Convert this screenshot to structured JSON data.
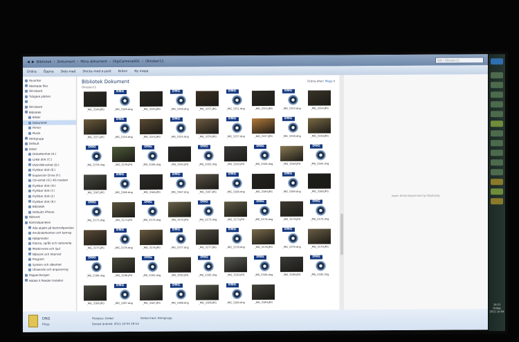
{
  "address": {
    "crumbs": [
      "Bibliotek",
      "Dokument",
      "Mina dokument",
      "DigiCamera001",
      "Oktober11"
    ],
    "search_placeholder": "Sök i Oktober11"
  },
  "toolbar": {
    "items": [
      "Ordna",
      "Öppna",
      "Dela med",
      "Skicka med e-post",
      "Bränn",
      "Ny mapp"
    ]
  },
  "nav": {
    "items": [
      {
        "label": "Favoriter"
      },
      {
        "label": "Hämtade filer"
      },
      {
        "label": "Skrivbord"
      },
      {
        "label": "Tidigare platser"
      },
      {
        "label": ""
      },
      {
        "label": "Skrivbord"
      },
      {
        "label": "Bibliotek"
      },
      {
        "label": "Bilder"
      },
      {
        "label": "Dokument",
        "selected": true
      },
      {
        "label": "Filmer"
      },
      {
        "label": "Musik"
      },
      {
        "label": "Hemgrupp"
      },
      {
        "label": "Default"
      },
      {
        "label": "Dator"
      },
      {
        "label": "Diskettenhet (A:)"
      },
      {
        "label": "Lokal disk (C:)"
      },
      {
        "label": "DVD-RW-enhet (D:)"
      },
      {
        "label": "Flyttbar disk (E:)"
      },
      {
        "label": "Expansion Drive (F:)"
      },
      {
        "label": "CD-enhet (G:) 4G-modem"
      },
      {
        "label": "Flyttbar disk (H:)"
      },
      {
        "label": "Flyttbar disk (I:)"
      },
      {
        "label": "Flyttbar disk (J:)"
      },
      {
        "label": "Flyttbar disk (K:)"
      },
      {
        "label": "Bibliotek"
      },
      {
        "label": "Defaults iPhone"
      },
      {
        "label": "Nätverk"
      },
      {
        "label": "Kontrollpanelen"
      },
      {
        "label": "Alla objekt på Kontrollpanelen"
      },
      {
        "label": "Användarkonton och barnsp"
      },
      {
        "label": "Hjälpmedel"
      },
      {
        "label": "Klocka, språk och nationella"
      },
      {
        "label": "Maskinvara och ljud"
      },
      {
        "label": "Nätverk och Internet"
      },
      {
        "label": "Program"
      },
      {
        "label": "System och säkerhet"
      },
      {
        "label": "Utseende och anpassning"
      },
      {
        "label": "Papperskorgen"
      },
      {
        "label": "Adobe X Reader Installer"
      }
    ]
  },
  "content": {
    "title": "Bibliotek Dokument",
    "subtitle": "Oktober11",
    "arrange_label": "Ordna efter:",
    "arrange_value": "Mapp"
  },
  "files": [
    {
      "name": "_MG_3148.JPG",
      "kind": "photo",
      "color": "#2c2a24"
    },
    {
      "name": "_MG_3149.dng",
      "kind": "dng"
    },
    {
      "name": "_MG_3150.JPG",
      "kind": "photo",
      "color": "#2a2822"
    },
    {
      "name": "_MG_3150.dng",
      "kind": "dng"
    },
    {
      "name": "_MG_3151.JPG",
      "kind": "photo",
      "color": "#3a2f20"
    },
    {
      "name": "_MG_3151.dng",
      "kind": "dng"
    },
    {
      "name": "_MG_3152.JPG",
      "kind": "photo",
      "color": "#2e2b24"
    },
    {
      "name": "_MG_3153.dng",
      "kind": "dng"
    },
    {
      "name": "_MG_3154.JPG",
      "kind": "photo",
      "color": "#3a3428"
    },
    {
      "name": "_MG_3153.JPG",
      "kind": "photo",
      "color": "#6b5a3a"
    },
    {
      "name": "_MG_3154.dng",
      "kind": "dng"
    },
    {
      "name": "_MG_3154.JPG",
      "kind": "photo",
      "color": "#5a4a33"
    },
    {
      "name": "_MG_3155.dng",
      "kind": "dng"
    },
    {
      "name": "_MG_3156.JPG",
      "kind": "photo",
      "color": "#6e5b40"
    },
    {
      "name": "_MG_3157.dng",
      "kind": "dng"
    },
    {
      "name": "_MG_3157.JPG",
      "kind": "photo",
      "color": "#b27a3a"
    },
    {
      "name": "_MG_3158.dng",
      "kind": "dng"
    },
    {
      "name": "_MG_3158.JPG",
      "kind": "photo",
      "color": "#7a6a45"
    },
    {
      "name": "_MG_3159.dng",
      "kind": "dng"
    },
    {
      "name": "_MG_3159.JPG",
      "kind": "photo",
      "color": "#4e5a3a"
    },
    {
      "name": "_MG_3160.dng",
      "kind": "dng"
    },
    {
      "name": "_MG_3161.JPG",
      "kind": "photo",
      "color": "#2a2a2a"
    },
    {
      "name": "_MG_3162.dng",
      "kind": "dng"
    },
    {
      "name": "_MG_3163.JPG",
      "kind": "photo",
      "color": "#3a3a3a"
    },
    {
      "name": "_MG_3164.dng",
      "kind": "dng"
    },
    {
      "name": "_MG_3164.JPG",
      "kind": "photo",
      "color": "#8a7a55"
    },
    {
      "name": "_MG_3165.dng",
      "kind": "dng"
    },
    {
      "name": "_MG_3165.JPG",
      "kind": "photo",
      "color": "#4a4a44"
    },
    {
      "name": "_MG_3166.dng",
      "kind": "dng"
    },
    {
      "name": "_MG_3166.JPG",
      "kind": "photo",
      "color": "#2c2c2a"
    },
    {
      "name": "_MG_3167.dng",
      "kind": "dng"
    },
    {
      "name": "_MG_3167.JPG",
      "kind": "photo",
      "color": "#5a5248"
    },
    {
      "name": "_MG_3168.dng",
      "kind": "dng"
    },
    {
      "name": "_MG_3169.JPG",
      "kind": "photo",
      "color": "#26241f"
    },
    {
      "name": "_MG_3169.dng",
      "kind": "dng"
    },
    {
      "name": "_MG_3168.JPG",
      "kind": "photo",
      "color": "#1e1e1c"
    },
    {
      "name": "_MG_3171.dng",
      "kind": "dng"
    },
    {
      "name": "_MG_3171.JPG",
      "kind": "photo",
      "color": "#5c553f"
    },
    {
      "name": "_MG_3172.dng",
      "kind": "dng"
    },
    {
      "name": "_MG_3172.JPG",
      "kind": "photo",
      "color": "#6a6248"
    },
    {
      "name": "_MG_3173.dng",
      "kind": "dng"
    },
    {
      "name": "_MG_3173.JPG",
      "kind": "photo",
      "color": "#5e5a45"
    },
    {
      "name": "_MG_3174.dng",
      "kind": "dng"
    },
    {
      "name": "_MG_3174.JPG",
      "kind": "photo",
      "color": "#3c3a30"
    },
    {
      "name": "_MG_3175.dng",
      "kind": "dng"
    },
    {
      "name": "_MG_3175.JPG",
      "kind": "photo",
      "color": "#5a4a35"
    },
    {
      "name": "_MG_3176.dng",
      "kind": "dng"
    },
    {
      "name": "_MG_3176.JPG",
      "kind": "photo",
      "color": "#6a5a40"
    },
    {
      "name": "_MG_3177.dng",
      "kind": "dng"
    },
    {
      "name": "_MG_3177.JPG",
      "kind": "photo",
      "color": "#4e4a40"
    },
    {
      "name": "_MG_3178.dng",
      "kind": "dng"
    },
    {
      "name": "_MG_3178.JPG",
      "kind": "photo",
      "color": "#7a6a4a"
    },
    {
      "name": "_MG_3179.dng",
      "kind": "dng"
    },
    {
      "name": "_MG_3179.JPG",
      "kind": "photo",
      "color": "#6a5e44"
    },
    {
      "name": "_MG_3180.dng",
      "kind": "dng"
    },
    {
      "name": "_MG_3180.JPG",
      "kind": "photo",
      "color": "#4a4a3e"
    },
    {
      "name": "_MG_3181.dng",
      "kind": "dng"
    },
    {
      "name": "_MG_3181.JPG",
      "kind": "photo",
      "color": "#4e4a3c"
    },
    {
      "name": "_MG_3182.dng",
      "kind": "dng"
    },
    {
      "name": "_MG_3183.JPG",
      "kind": "photo",
      "color": "#5a5a55"
    },
    {
      "name": "_MG_3184.dng",
      "kind": "dng"
    },
    {
      "name": "_MG_3184.JPG",
      "kind": "photo",
      "color": "#3a3a36"
    },
    {
      "name": "_MG_3185.dng",
      "kind": "dng"
    },
    {
      "name": "_MG_3186.JPG",
      "kind": "photo",
      "color": "#4a4a40"
    },
    {
      "name": "_MG_3187.dng",
      "kind": "dng"
    },
    {
      "name": "_MG_3187.JPG",
      "kind": "photo",
      "color": "#5a5a50"
    },
    {
      "name": "_MG_3188.dng",
      "kind": "dng"
    },
    {
      "name": "_MG_3188.JPG",
      "kind": "photo",
      "color": "#56564c"
    },
    {
      "name": "_MG_3189.dng",
      "kind": "dng"
    },
    {
      "name": "_MG_3189.JPG",
      "kind": "photo",
      "color": "#44443c"
    }
  ],
  "preview": {
    "message": "Ingen förhandsgranskning tillgänglig."
  },
  "details": {
    "name": "DNG",
    "type": "Filtyp",
    "state_label": "Filstatus:",
    "state_value": "Delad",
    "date_label": "Senast ändrad:",
    "date_value": "2011-10-04 19:14",
    "shared_label": "Delad med:",
    "shared_value": "Hemgrupp"
  },
  "clock": {
    "time": "19:53",
    "day": "tisdag",
    "date": "2011-10-04"
  },
  "colors": {
    "dng_tag": "#163a82",
    "selection": "#c9dcf4",
    "title_text": "#1e3b66"
  }
}
